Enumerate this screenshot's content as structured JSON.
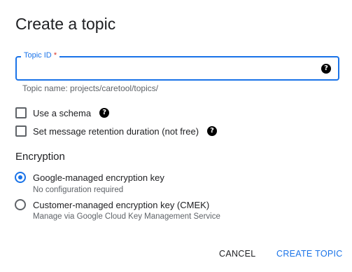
{
  "dialog": {
    "title": "Create a topic"
  },
  "topic_id": {
    "label": "Topic ID",
    "required_mark": "*",
    "value": "",
    "hint": "Topic name: projects/caretool/topics/",
    "help_icon": "help-circle-icon"
  },
  "options": {
    "use_schema": {
      "label": "Use a schema",
      "checked": false,
      "help_icon": "help-circle-icon"
    },
    "retention": {
      "label": "Set message retention duration (not free)",
      "checked": false,
      "help_icon": "help-circle-icon"
    }
  },
  "encryption": {
    "title": "Encryption",
    "google_managed": {
      "label": "Google-managed encryption key",
      "description": "No configuration required",
      "selected": true
    },
    "customer_managed": {
      "label": "Customer-managed encryption key (CMEK)",
      "description": "Manage via Google Cloud Key Management Service",
      "selected": false
    }
  },
  "actions": {
    "cancel_label": "CANCEL",
    "create_label": "CREATE TOPIC"
  },
  "colors": {
    "accent": "#1a73e8",
    "required": "#d93025",
    "text": "#202124",
    "secondary_text": "#5f6368"
  }
}
